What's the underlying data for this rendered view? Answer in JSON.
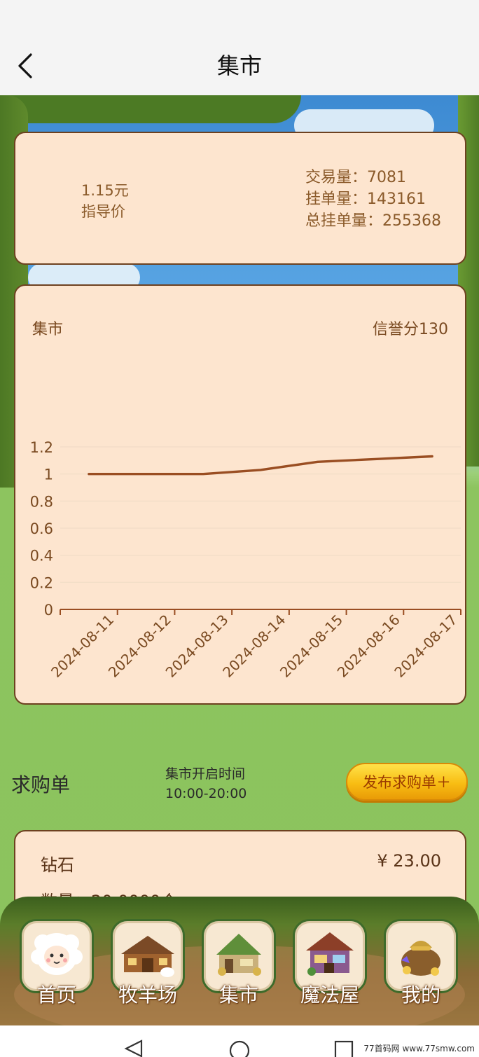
{
  "header": {
    "title": "集市"
  },
  "summary": {
    "price": "1.15元",
    "price_label": "指导价",
    "volume": "交易量：7081",
    "listed": "挂单量：143161",
    "total_listed": "总挂单量：255368"
  },
  "chart_card": {
    "title": "集市",
    "credit": "信誉分130"
  },
  "chart_data": {
    "type": "line",
    "x": [
      "2024-08-11",
      "2024-08-12",
      "2024-08-13",
      "2024-08-14",
      "2024-08-15",
      "2024-08-16",
      "2024-08-17"
    ],
    "series": [
      {
        "values": [
          1.0,
          1.0,
          1.0,
          1.03,
          1.09,
          1.11,
          1.13
        ]
      }
    ],
    "yticks": [
      "0",
      "0.2",
      "0.4",
      "0.6",
      "0.8",
      "1",
      "1.2"
    ],
    "ylim": [
      0,
      1.2
    ],
    "grid": true,
    "colors": {
      "line": "#9a4e22",
      "grid": "#f1dcc6",
      "axis": "#9a4e22"
    }
  },
  "orders": {
    "title": "求购单",
    "open_label": "集市开启时间",
    "open_hours": "10:00-20:00",
    "publish_label": "发布求购单＋"
  },
  "item": {
    "name": "钻石",
    "price": "¥ 23.00",
    "qty": "数量：20.0000个"
  },
  "nav": [
    {
      "label": "首页",
      "icon": "sheep-icon"
    },
    {
      "label": "牧羊场",
      "icon": "barn-icon"
    },
    {
      "label": "集市",
      "icon": "market-icon"
    },
    {
      "label": "魔法屋",
      "icon": "magic-house-icon"
    },
    {
      "label": "我的",
      "icon": "treasure-bag-icon"
    }
  ],
  "watermark": "77首码网 www.77smw.com"
}
